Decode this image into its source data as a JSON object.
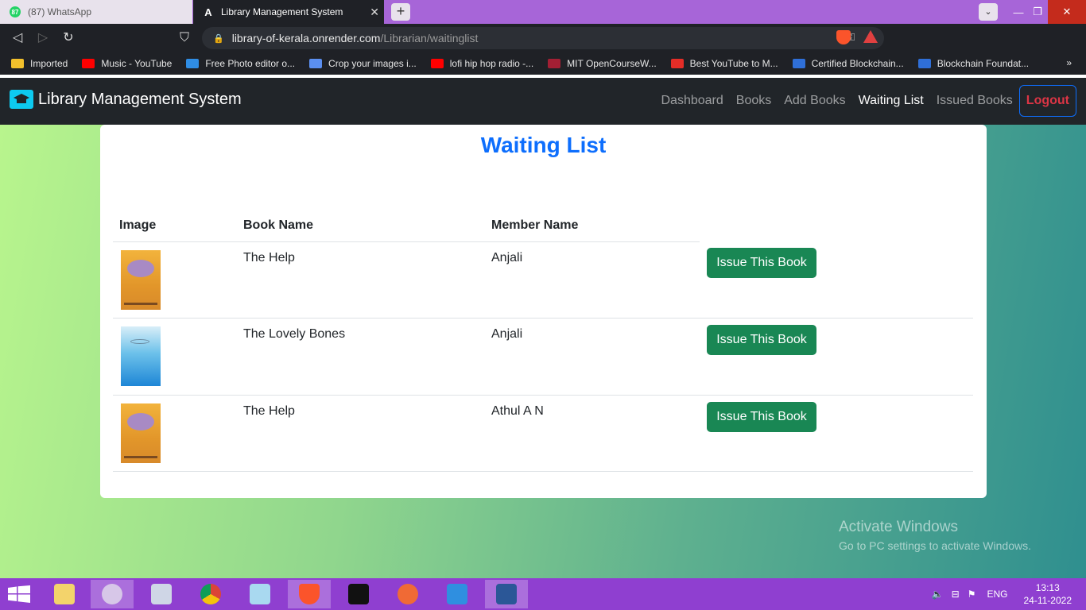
{
  "browser": {
    "tabs": [
      {
        "title": "(87) WhatsApp",
        "badge": "87"
      },
      {
        "title": "Library Management System"
      }
    ],
    "url_host": "library-of-kerala.onrender.com",
    "url_path": "/Librarian/waitinglist",
    "bookmarks": [
      {
        "label": "Imported",
        "color": "#f2c02c"
      },
      {
        "label": "Music - YouTube",
        "color": "#ff0000"
      },
      {
        "label": "Free Photo editor o...",
        "color": "#2f8de4"
      },
      {
        "label": "Crop your images i...",
        "color": "#5b8ff0"
      },
      {
        "label": "lofi hip hop radio -...",
        "color": "#ff0000"
      },
      {
        "label": "MIT OpenCourseW...",
        "color": "#a31f34"
      },
      {
        "label": "Best YouTube to M...",
        "color": "#e52d27"
      },
      {
        "label": "Certified Blockchain...",
        "color": "#2f6fd8"
      },
      {
        "label": "Blockchain Foundat...",
        "color": "#2f6fd8"
      }
    ]
  },
  "app": {
    "brand": "Library Management System",
    "nav": [
      "Dashboard",
      "Books",
      "Add Books",
      "Waiting List",
      "Issued Books"
    ],
    "logout": "Logout"
  },
  "main": {
    "title": "Waiting List",
    "columns": [
      "Image",
      "Book Name",
      "Member Name"
    ],
    "rows": [
      {
        "book": "The Help",
        "member": "Anjali",
        "action": "Issue This Book"
      },
      {
        "book": "The Lovely Bones",
        "member": "Anjali",
        "action": "Issue This Book"
      },
      {
        "book": "The Help",
        "member": "Athul A N",
        "action": "Issue This Book"
      }
    ]
  },
  "watermark": {
    "line1": "Activate Windows",
    "line2": "Go to PC settings to activate Windows."
  },
  "taskbar": {
    "lang": "ENG",
    "time": "13:13",
    "date": "24-11-2022"
  },
  "colors": {
    "accent": "#0d6efd",
    "success": "#198754",
    "danger": "#dc3545",
    "navbar": "#212529"
  }
}
